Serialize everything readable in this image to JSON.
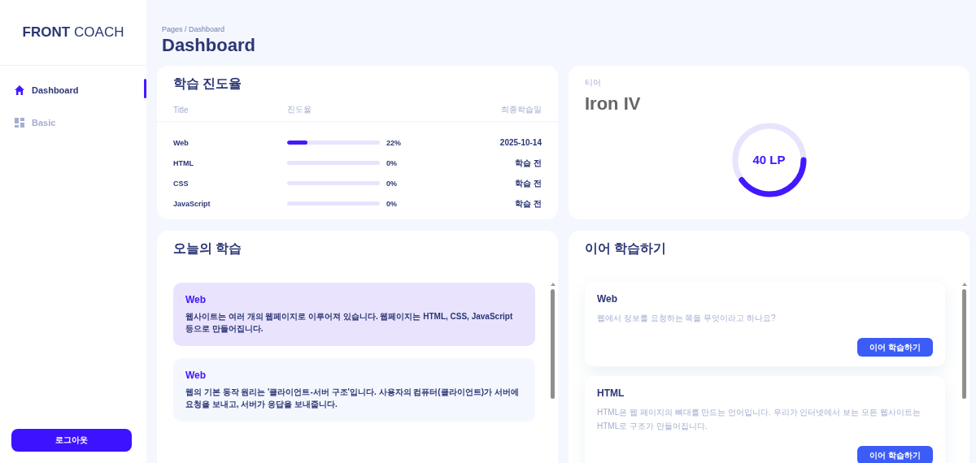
{
  "sidebar": {
    "logo_bold": "FRONT",
    "logo_light": "COACH",
    "items": [
      {
        "label": "Dashboard",
        "selected": true
      },
      {
        "label": "Basic",
        "selected": false
      }
    ],
    "logout": "로그아웃"
  },
  "header": {
    "breadcrumb": "Pages / Dashboard",
    "title": "Dashboard"
  },
  "progress": {
    "title": "학습 진도율",
    "columns": [
      "Title",
      "진도율",
      "최종학습일"
    ],
    "rows": [
      {
        "title": "Web",
        "level": 0.22,
        "percent": "22%",
        "date": "2025-10-14"
      },
      {
        "title": "HTML",
        "level": 0,
        "percent": "0%",
        "date": "학습 전"
      },
      {
        "title": "CSS",
        "level": 0,
        "percent": "0%",
        "date": "학습 전"
      },
      {
        "title": "JavaScript",
        "level": 0,
        "percent": "0%",
        "date": "학습 전"
      }
    ]
  },
  "tier": {
    "label": "티어",
    "name": "Iron IV",
    "level": 0.4,
    "points": "40 LP"
  },
  "today": {
    "title": "오늘의 학습",
    "items": [
      {
        "topic": "Web",
        "text": "웹사이트는 여러 개의 웹페이지로 이루어져 있습니다. 웹페이지는 HTML, CSS, JavaScript 등으로 만들어집니다.",
        "highlighted": true
      },
      {
        "topic": "Web",
        "text": "웹의 기본 동작 원리는 '클라이언트-서버 구조'입니다. 사용자의 컴퓨터(클라이언트)가 서버에 요청을 보내고, 서버가 응답을 보내줍니다.",
        "highlighted": false
      }
    ]
  },
  "continue": {
    "title": "이어 학습하기",
    "items": [
      {
        "topic": "Web",
        "text": "웹에서 정보를 요청하는 쪽을 무엇이라고 하나요?",
        "button": "이어 학습하기"
      },
      {
        "topic": "HTML",
        "text": "HTML은 웹 페이지의 뼈대를 만드는 언어입니다. 우리가 인터넷에서 보는 모든 웹사이트는 HTML로 구조가 만들어집니다.",
        "button": "이어 학습하기"
      }
    ]
  }
}
